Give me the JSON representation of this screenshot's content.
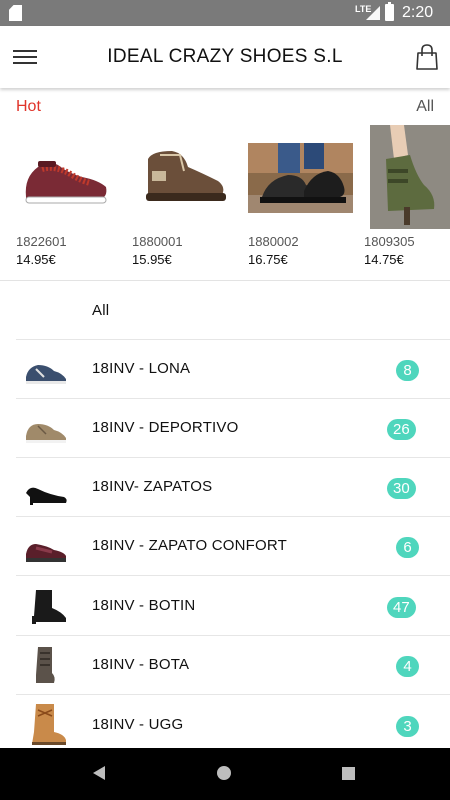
{
  "status_bar": {
    "network": "LTE",
    "time": "2:20"
  },
  "app_bar": {
    "title": "IDEAL CRAZY SHOES S.L"
  },
  "hot": {
    "label": "Hot",
    "all_label": "All",
    "products": [
      {
        "code": "1822601",
        "price": "14.95€"
      },
      {
        "code": "1880001",
        "price": "15.95€"
      },
      {
        "code": "1880002",
        "price": "16.75€"
      },
      {
        "code": "1809305",
        "price": "14.75€"
      }
    ]
  },
  "categories": {
    "all_label": "All",
    "items": [
      {
        "label": "18INV - LONA",
        "count": "8"
      },
      {
        "label": "18INV - DEPORTIVO",
        "count": "26"
      },
      {
        "label": "18INV- ZAPATOS",
        "count": "30"
      },
      {
        "label": "18INV - ZAPATO CONFORT",
        "count": "6"
      },
      {
        "label": "18INV - BOTIN",
        "count": "47"
      },
      {
        "label": "18INV - BOTA",
        "count": "4"
      },
      {
        "label": "18INV - UGG",
        "count": "3"
      }
    ]
  },
  "colors": {
    "accent_hot": "#e0342a",
    "badge": "#4fd6bd"
  }
}
